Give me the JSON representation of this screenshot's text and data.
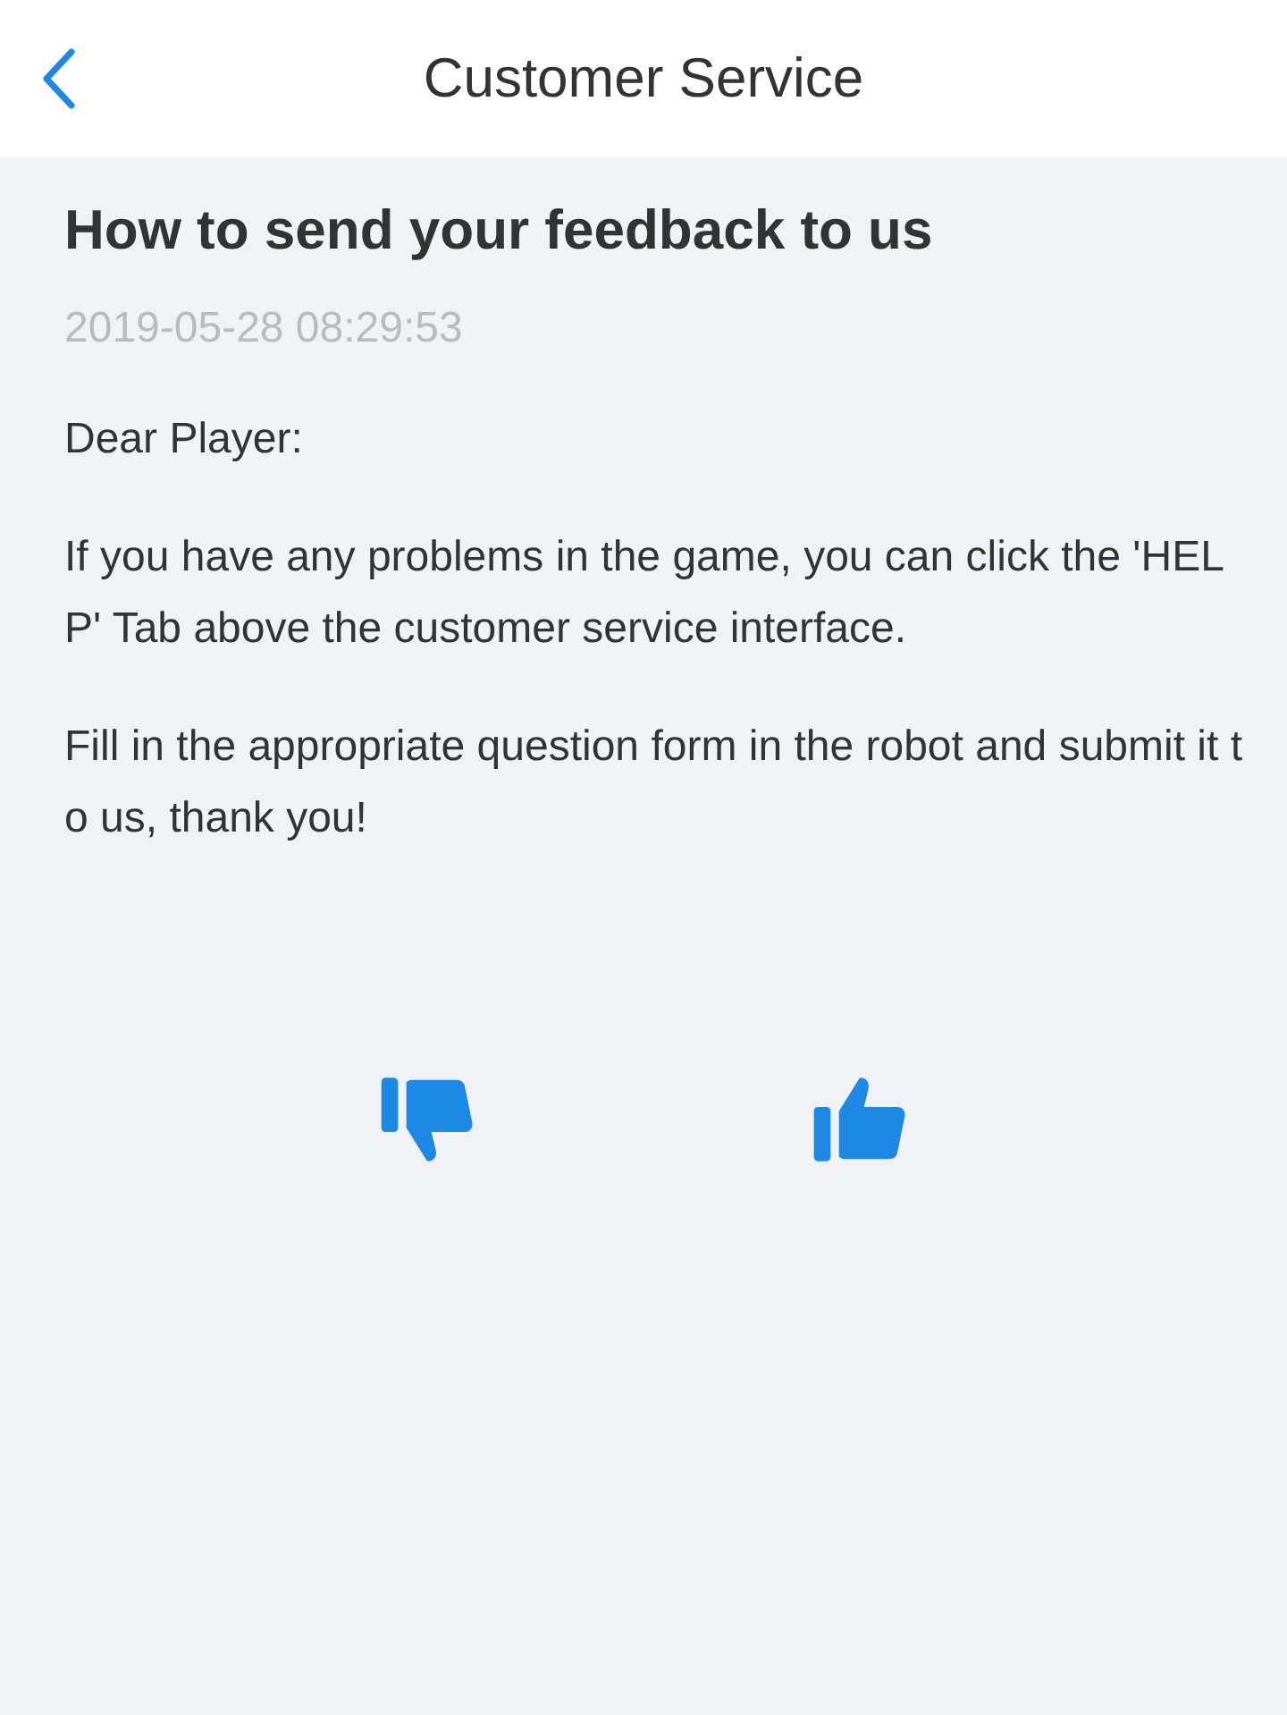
{
  "header": {
    "title": "Customer Service"
  },
  "article": {
    "title": "How to send your feedback to us",
    "date": "2019-05-28 08:29:53",
    "paragraphs": [
      "Dear Player:",
      "If you have any problems in the game, you can click the 'HELP' Tab above the customer service interface.",
      "Fill in the appropriate question form in the robot and submit it to us, thank you!"
    ]
  }
}
